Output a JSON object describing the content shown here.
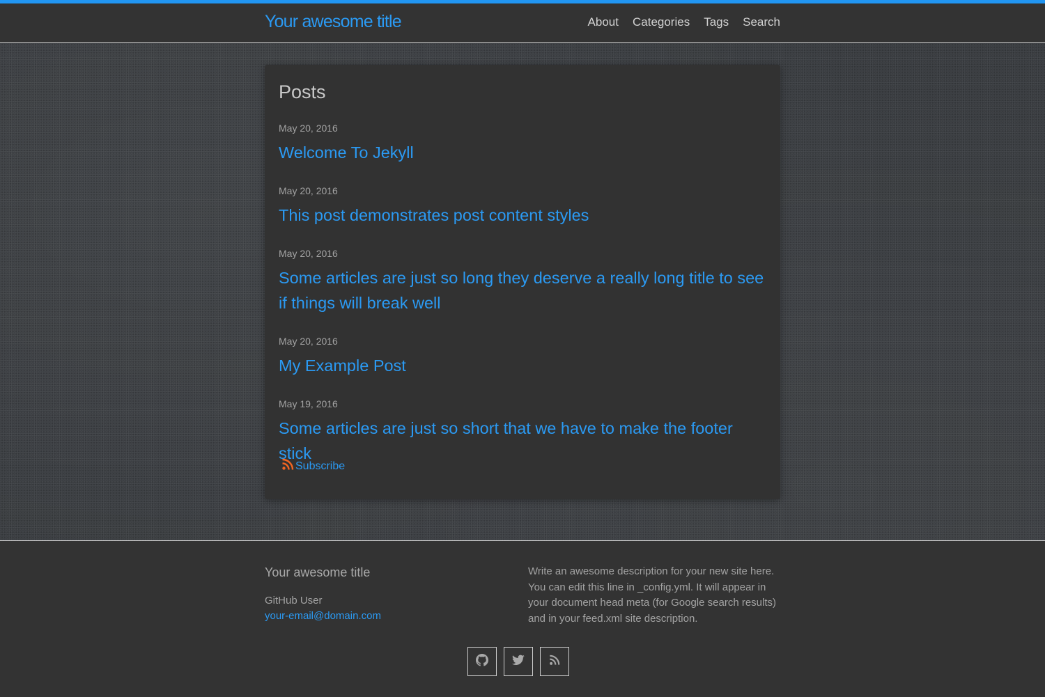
{
  "header": {
    "site_title": "Your awesome title",
    "nav": [
      "About",
      "Categories",
      "Tags",
      "Search"
    ]
  },
  "main": {
    "heading": "Posts",
    "posts": [
      {
        "date": "May 20, 2016",
        "title": "Welcome To Jekyll"
      },
      {
        "date": "May 20, 2016",
        "title": "This post demonstrates post content styles"
      },
      {
        "date": "May 20, 2016",
        "title": "Some articles are just so long they deserve a really long title to see if things will break well"
      },
      {
        "date": "May 20, 2016",
        "title": "My Example Post"
      },
      {
        "date": "May 19, 2016",
        "title": "Some articles are just so short that we have to make the footer stick"
      }
    ],
    "subscribe_label": "Subscribe",
    "subscribe_icon": "rss-icon"
  },
  "footer": {
    "title": "Your awesome title",
    "user": "GitHub User",
    "email": "your-email@domain.com",
    "description": "Write an awesome description for your new site here. You can edit this line in _config.yml. It will appear in your document head meta (for Google search results) and in your feed.xml site description.",
    "social_icons": [
      "github-icon",
      "twitter-icon",
      "rss-icon"
    ]
  },
  "colors": {
    "accent": "#2196f3",
    "link": "#2b9af3",
    "rss": "#f26522"
  }
}
